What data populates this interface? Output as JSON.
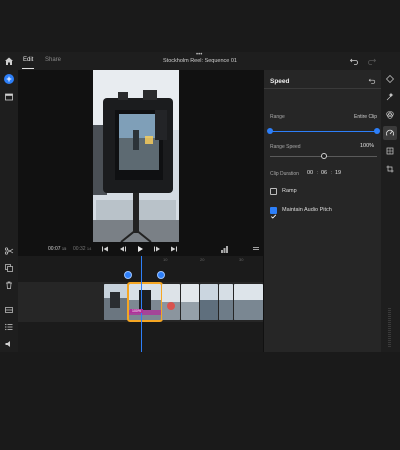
{
  "topbar": {
    "tabs": [
      {
        "label": "Edit",
        "active": true
      },
      {
        "label": "Share",
        "active": false
      }
    ],
    "title": "Stockholm Reel: Sequence 01",
    "more": "•••"
  },
  "player": {
    "current_time": "00:07",
    "current_frames": "15",
    "duration": "00:32",
    "duration_frames": "14"
  },
  "timeline": {
    "ruler_labels": [
      "10",
      "20",
      "30"
    ],
    "speed_badge": "100%"
  },
  "panel": {
    "title": "Speed",
    "range_label": "Range",
    "range_value": "Entire Clip",
    "range_speed_label": "Range Speed",
    "range_speed_value": "100%",
    "range_speed_fraction": 0.5,
    "clip_duration_label": "Clip Duration",
    "clip_duration": [
      "00",
      "06",
      "19"
    ],
    "ramp_label": "Ramp",
    "ramp_checked": false,
    "maintain_label": "Maintain Audio Pitch",
    "maintain_checked": true
  },
  "colors": {
    "accent": "#2d7ff9",
    "clip_selected": "#f5a623",
    "speed_badge": "#b1309a"
  },
  "icons": {
    "left": [
      "home-icon",
      "add-media-icon",
      "media-library-icon",
      "scissors-icon",
      "duplicate-icon",
      "trash-icon",
      "track-icon",
      "list-icon",
      "audio-icon"
    ],
    "right": [
      "shapes-icon",
      "magic-icon",
      "color-icon",
      "speed-icon",
      "crop-icon",
      "transform-icon"
    ]
  }
}
